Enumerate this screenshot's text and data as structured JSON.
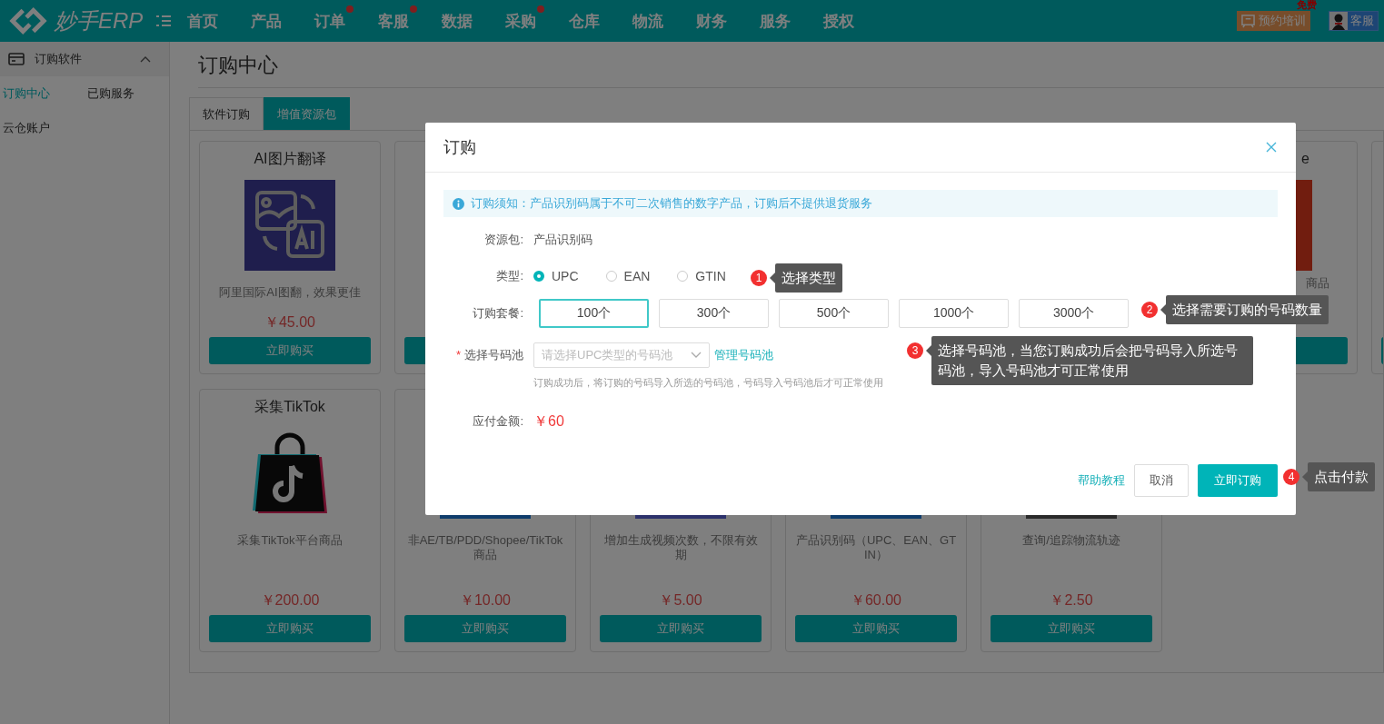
{
  "header": {
    "logo_text": "妙手ERP",
    "nav": [
      {
        "label": "首页",
        "badge": false
      },
      {
        "label": "产品",
        "badge": false
      },
      {
        "label": "订单",
        "badge": true
      },
      {
        "label": "客服",
        "badge": true
      },
      {
        "label": "数据",
        "badge": false
      },
      {
        "label": "采购",
        "badge": true
      },
      {
        "label": "仓库",
        "badge": false
      },
      {
        "label": "物流",
        "badge": false
      },
      {
        "label": "财务",
        "badge": false
      },
      {
        "label": "服务",
        "badge": false
      },
      {
        "label": "授权",
        "badge": false
      }
    ],
    "training_button": "预约培训",
    "free_tag": "免费",
    "support_button": "客服"
  },
  "sidebar": {
    "group": {
      "label": "订购软件",
      "expanded": true
    },
    "items": [
      {
        "label": "订购中心",
        "selected": true
      },
      {
        "label": "已购服务",
        "selected": false
      },
      {
        "label": "云仓账户",
        "selected": false
      }
    ]
  },
  "page_title": "订购中心",
  "tabs": [
    {
      "label": "软件订购",
      "selected": false
    },
    {
      "label": "增值资源包",
      "selected": true
    }
  ],
  "cards": [
    {
      "kind": "translation",
      "title": "AI图片翻译",
      "description": "阿里国际AI图翻，效果更佳",
      "price": "￥45.00",
      "button": "立即购买"
    },
    {
      "kind": "hidden"
    },
    {
      "kind": "covered"
    },
    {
      "kind": "covered"
    },
    {
      "kind": "covered"
    },
    {
      "kind": "partial",
      "title": "e",
      "description": "商品"
    },
    {
      "kind": "hidden"
    },
    {
      "kind": "tiktok",
      "title": "采集TikTok",
      "description": "采集TikTok平台商品",
      "price": "￥200.00",
      "button": "立即购买"
    },
    {
      "kind": "product",
      "description": "非AE/TB/PDD/Shopee/TikTok商品",
      "price": "￥10.00",
      "button": "立即购买"
    },
    {
      "kind": "product",
      "description": "增加生成视频次数，不限有效期",
      "price": "￥5.00",
      "button": "立即购买"
    },
    {
      "kind": "product",
      "description": "产品识别码（UPC、EAN、GTIN）",
      "price": "￥60.00",
      "button": "立即购买"
    },
    {
      "kind": "product",
      "description": "查询/追踪物流轨迹",
      "price": "￥2.50",
      "button": "立即购买"
    }
  ],
  "dialog": {
    "title": "订购",
    "notice": "订购须知：产品识别码属于不可二次销售的数字产品，订购后不提供退货服务",
    "resource_label": "资源包:",
    "resource_value": "产品识别码",
    "type_label": "类型:",
    "types": [
      {
        "label": "UPC",
        "selected": true
      },
      {
        "label": "EAN",
        "selected": false
      },
      {
        "label": "GTIN",
        "selected": false
      }
    ],
    "package_label": "订购套餐:",
    "packages": [
      {
        "label": "100个",
        "selected": true
      },
      {
        "label": "300个",
        "selected": false
      },
      {
        "label": "500个",
        "selected": false
      },
      {
        "label": "1000个",
        "selected": false
      },
      {
        "label": "3000个",
        "selected": false
      }
    ],
    "pool_required_mark": "*",
    "pool_label": "选择号码池",
    "pool_placeholder": "请选择UPC类型的号码池",
    "pool_link": "管理号码池",
    "pool_hint": "订购成功后，将订购的号码导入所选的号码池，号码导入号码池后才可正常使用",
    "amount_label": "应付金额:",
    "amount": "￥60",
    "help_link": "帮助教程",
    "cancel_button": "取消",
    "confirm_button": "立即订购"
  },
  "callouts": [
    {
      "number": "1",
      "text": "选择类型"
    },
    {
      "number": "2",
      "text": "选择需要订购的号码数量"
    },
    {
      "number": "3",
      "text": "选择号码池，当您订购成功后会把号码导入所选号码池，导入号码池才可正常使用"
    },
    {
      "number": "4",
      "text": "点击付款"
    }
  ]
}
